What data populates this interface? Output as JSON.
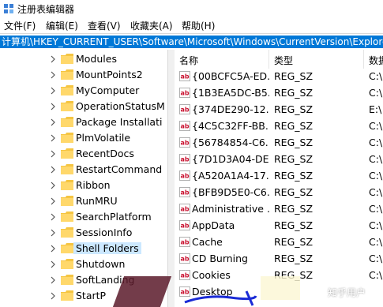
{
  "window": {
    "title": "注册表编辑器"
  },
  "menu": [
    "文件(F)",
    "编辑(E)",
    "查看(V)",
    "收藏夹(A)",
    "帮助(H)"
  ],
  "address": "计算机\\HKEY_CURRENT_USER\\Software\\Microsoft\\Windows\\CurrentVersion\\Explorer\\Shell Folders",
  "tree": {
    "items": [
      {
        "label": "Modules",
        "selected": false
      },
      {
        "label": "MountPoints2",
        "selected": false
      },
      {
        "label": "MyComputer",
        "selected": false
      },
      {
        "label": "OperationStatusM",
        "selected": false
      },
      {
        "label": "Package Installati",
        "selected": false
      },
      {
        "label": "PlmVolatile",
        "selected": false
      },
      {
        "label": "RecentDocs",
        "selected": false
      },
      {
        "label": "RestartCommand",
        "selected": false
      },
      {
        "label": "Ribbon",
        "selected": false
      },
      {
        "label": "RunMRU",
        "selected": false
      },
      {
        "label": "SearchPlatform",
        "selected": false
      },
      {
        "label": "SessionInfo",
        "selected": false
      },
      {
        "label": "Shell Folders",
        "selected": true
      },
      {
        "label": "Shutdown",
        "selected": false
      },
      {
        "label": "SoftLanding",
        "selected": false
      },
      {
        "label": "StartP",
        "selected": false
      }
    ]
  },
  "list": {
    "headers": {
      "name": "名称",
      "type": "类型",
      "data": "数据"
    },
    "rows": [
      {
        "name": "{00BCFC5A-ED...",
        "type": "REG_SZ",
        "data": "C:\\"
      },
      {
        "name": "{1B3EA5DC-B5...",
        "type": "REG_SZ",
        "data": "C:\\"
      },
      {
        "name": "{374DE290-12...",
        "type": "REG_SZ",
        "data": "E:\\"
      },
      {
        "name": "{4C5C32FF-BB...",
        "type": "REG_SZ",
        "data": "C:\\"
      },
      {
        "name": "{56784854-C6...",
        "type": "REG_SZ",
        "data": "C:\\"
      },
      {
        "name": "{7D1D3A04-DE...",
        "type": "REG_SZ",
        "data": "C:\\"
      },
      {
        "name": "{A520A1A4-17...",
        "type": "REG_SZ",
        "data": "C:\\"
      },
      {
        "name": "{BFB9D5E0-C6...",
        "type": "REG_SZ",
        "data": "C:\\"
      },
      {
        "name": "Administrative ...",
        "type": "REG_SZ",
        "data": "C:\\"
      },
      {
        "name": "AppData",
        "type": "REG_SZ",
        "data": "C:\\"
      },
      {
        "name": "Cache",
        "type": "REG_SZ",
        "data": "C:\\"
      },
      {
        "name": "CD Burning",
        "type": "REG_SZ",
        "data": "C:\\"
      },
      {
        "name": "Cookies",
        "type": "REG_SZ",
        "data": "C:\\"
      },
      {
        "name": "Desktop",
        "type": "",
        "data": ""
      }
    ]
  },
  "watermark": "知乎用户",
  "colors": {
    "selection": "#0078d7",
    "tree_selected": "#cce8ff",
    "folder": "#f5c542"
  }
}
